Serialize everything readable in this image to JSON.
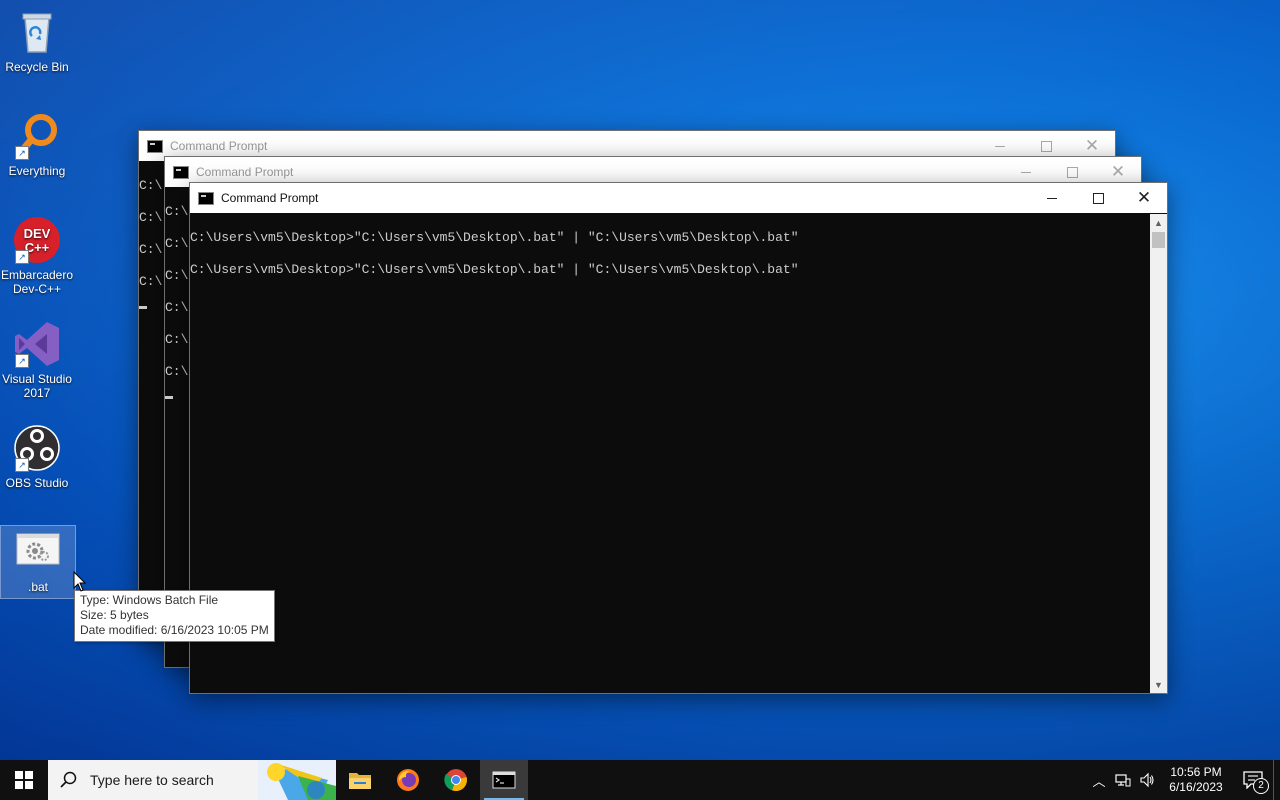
{
  "desktop": {
    "icons": [
      {
        "label": "Recycle Bin"
      },
      {
        "label": "Everything"
      },
      {
        "label": "Embarcadero Dev-C++",
        "badge": "DEV C++"
      },
      {
        "label": "Visual Studio 2017"
      },
      {
        "label": "OBS Studio"
      },
      {
        "label": ".bat"
      }
    ]
  },
  "windows": [
    {
      "title": "Command Prompt",
      "state": "inactive",
      "lines": [
        "C:\\",
        "C:\\",
        "C:\\",
        "C:\\"
      ]
    },
    {
      "title": "Command Prompt",
      "state": "inactive",
      "lines": [
        "C:\\",
        "C:\\",
        "C:\\",
        "C:\\",
        "C:\\",
        "C:\\"
      ]
    },
    {
      "title": "Command Prompt",
      "state": "active",
      "lines": [
        "C:\\Users\\vm5\\Desktop>\"C:\\Users\\vm5\\Desktop\\.bat\" | \"C:\\Users\\vm5\\Desktop\\.bat\"",
        "C:\\Users\\vm5\\Desktop>\"C:\\Users\\vm5\\Desktop\\.bat\" | \"C:\\Users\\vm5\\Desktop\\.bat\""
      ]
    }
  ],
  "tooltip": {
    "type": "Type: Windows Batch File",
    "size": "Size: 5 bytes",
    "modified": "Date modified: 6/16/2023 10:05 PM"
  },
  "taskbar": {
    "search_placeholder": "Type here to search",
    "apps": [
      "file-explorer",
      "firefox",
      "chrome",
      "command-prompt"
    ],
    "clock_time": "10:56 PM",
    "clock_date": "6/16/2023",
    "notification_count": "2"
  },
  "colors": {
    "console_bg": "#0c0c0c",
    "console_fg": "#cccccc",
    "taskbar_bg": "#101010",
    "active_indicator": "#76b9ed"
  }
}
